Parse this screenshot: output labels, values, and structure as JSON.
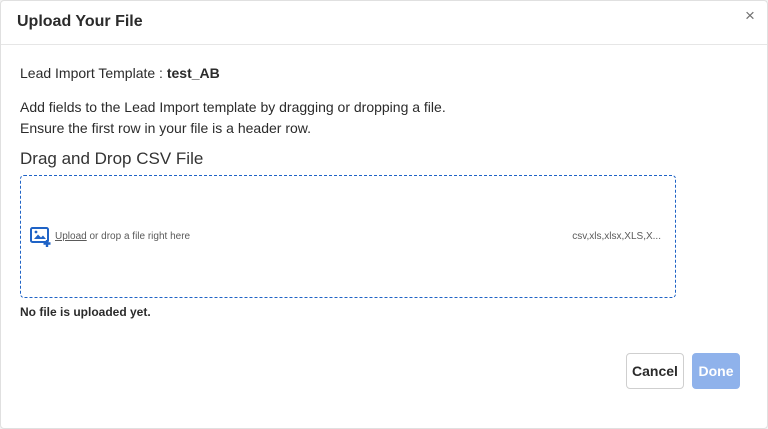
{
  "modal": {
    "title": "Upload Your File",
    "close_symbol": "×",
    "template_label": "Lead Import Template : ",
    "template_name": "test_AB",
    "description_line1": "Add fields to the Lead Import template by dragging or dropping a file.",
    "description_line2": "Ensure the first row in your file is a header row.",
    "dropzone_title": "Drag and Drop CSV File",
    "dropzone": {
      "icon": "image-upload-icon",
      "upload_link": "Upload",
      "upload_suffix": " or drop a file right here",
      "file_types": "csv,xls,xlsx,XLS,X..."
    },
    "status_text": "No file is uploaded yet.",
    "buttons": {
      "cancel": "Cancel",
      "done": "Done"
    },
    "colors": {
      "accent": "#1f63c6",
      "done_disabled": "#8fb2eb"
    }
  }
}
